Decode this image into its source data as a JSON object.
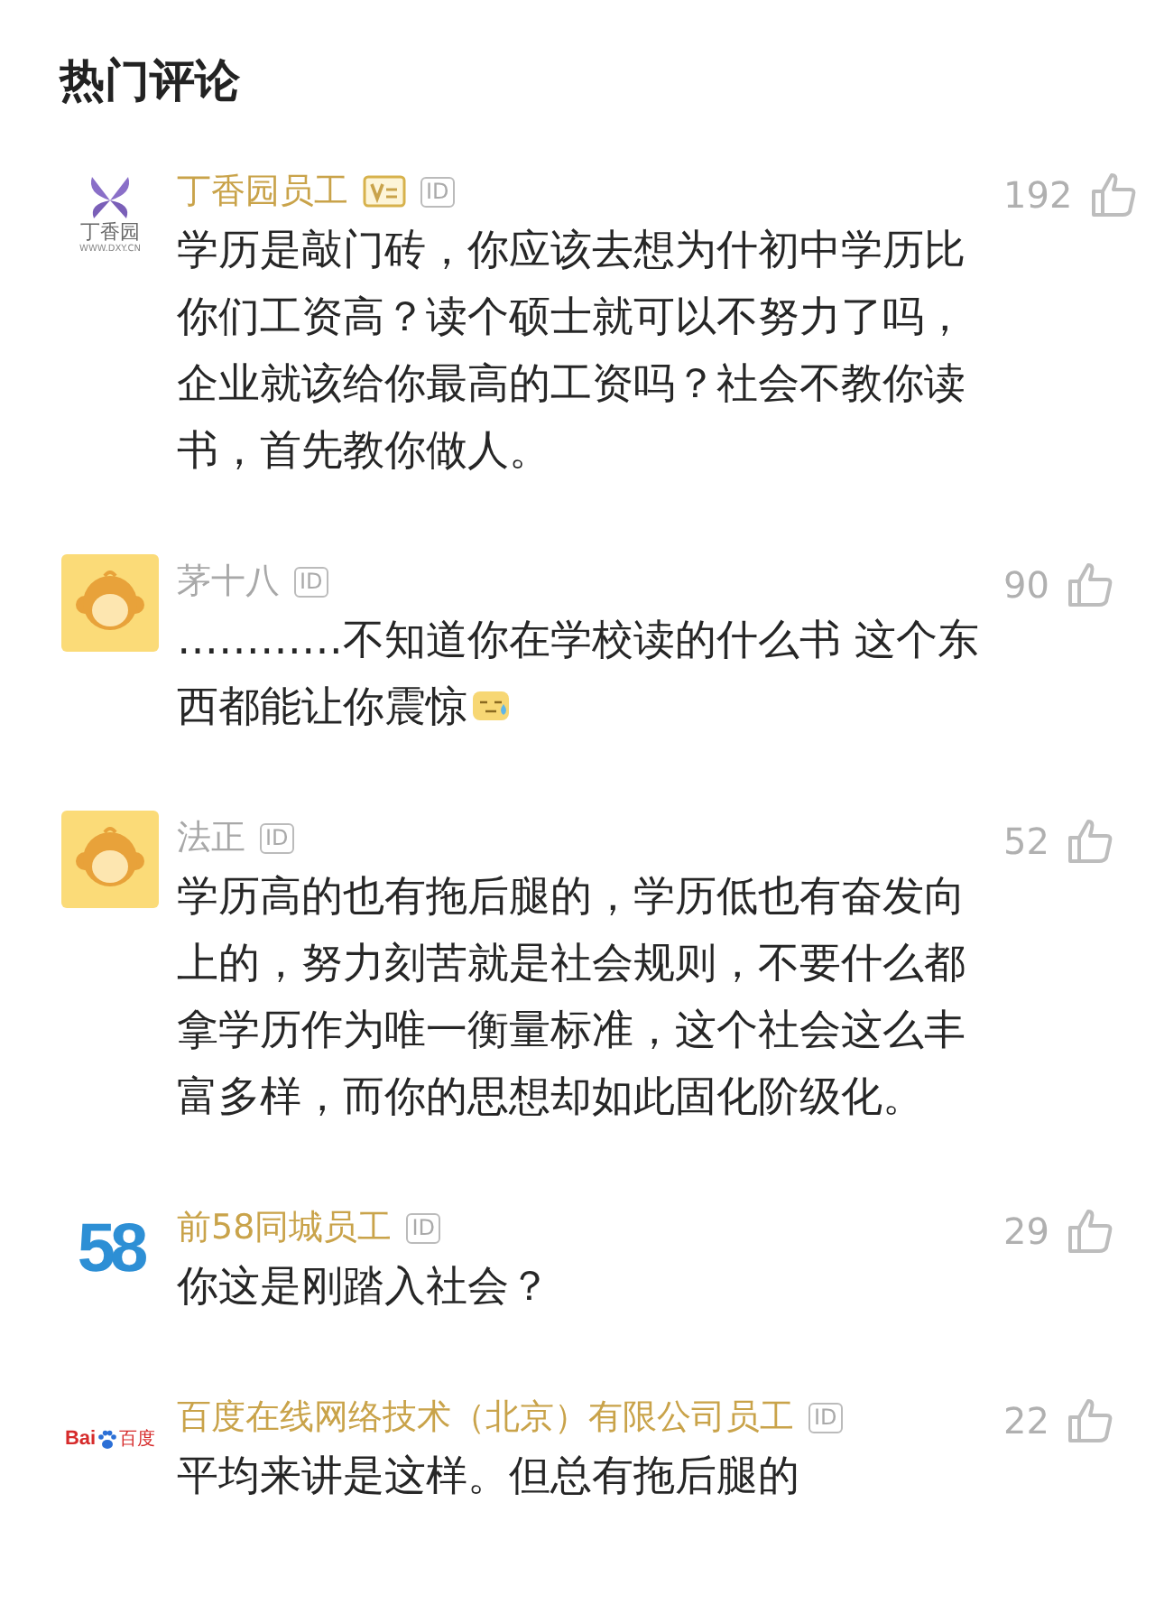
{
  "header": {
    "title": "热门评论"
  },
  "comments": [
    {
      "avatar": {
        "kind": "flower",
        "text": "丁香园",
        "subtext": "WWW.DXY.CN"
      },
      "name": "丁香园员工",
      "verified": true,
      "badge": true,
      "id_tag": "ID",
      "likes": "192",
      "text": "学历是敲门砖，你应该去想为什初中学历比你们工资高？读个硕士就可以不努力了吗，企业就该给你最高的工资吗？社会不教你读书，首先教你做人。"
    },
    {
      "avatar": {
        "kind": "monkey"
      },
      "name": "茅十八",
      "verified": false,
      "id_tag": "ID",
      "likes": "90",
      "text": "…………不知道你在学校读的什么书 这个东西都能让你震惊",
      "emoji": true
    },
    {
      "avatar": {
        "kind": "monkey"
      },
      "name": "法正",
      "verified": false,
      "id_tag": "ID",
      "likes": "52",
      "text": "学历高的也有拖后腿的，学历低也有奋发向上的，努力刻苦就是社会规则，不要什么都拿学历作为唯一衡量标准，这个社会这么丰富多样，而你的思想却如此固化阶级化。"
    },
    {
      "avatar": {
        "kind": "digits",
        "text": "58"
      },
      "name": "前58同城员工",
      "verified": true,
      "id_tag": "ID",
      "likes": "29",
      "text": "你这是刚踏入社会？"
    },
    {
      "avatar": {
        "kind": "paw",
        "text": "Bai",
        "subtext": "百度"
      },
      "name": "百度在线网络技术（北京）有限公司员工",
      "verified": true,
      "id_tag": "ID",
      "likes": "22",
      "text": "平均来讲是这样。但总有拖后腿的"
    }
  ]
}
